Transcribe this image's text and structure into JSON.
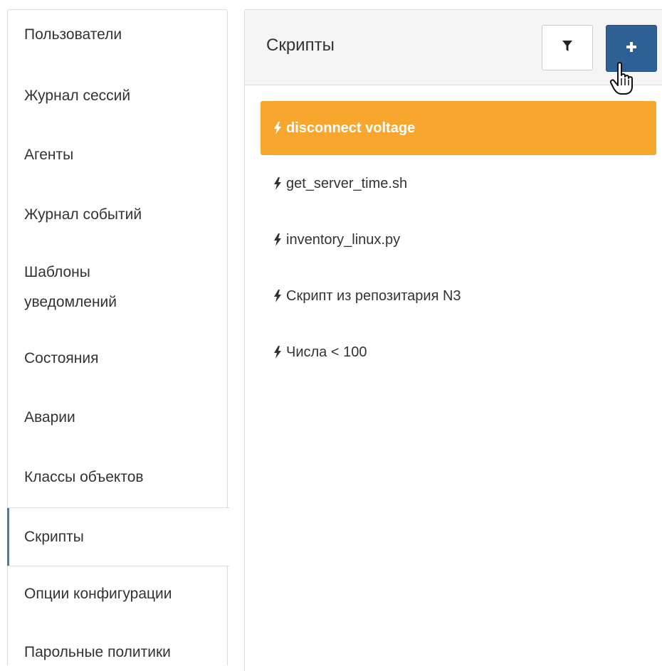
{
  "sidebar": {
    "items": [
      {
        "label": "Пользователи"
      },
      {
        "label": "Журнал сессий"
      },
      {
        "label": "Агенты"
      },
      {
        "label": "Журнал событий"
      },
      {
        "label": "Шаблоны уведомлений"
      },
      {
        "label": "Состояния"
      },
      {
        "label": "Аварии"
      },
      {
        "label": "Классы объектов"
      },
      {
        "label": "Скрипты",
        "active": true
      },
      {
        "label": "Опции конфигурации"
      },
      {
        "label": "Парольные политики"
      }
    ]
  },
  "panel": {
    "title": "Скрипты",
    "filter_icon": "filter-icon",
    "add_icon": "plus-icon"
  },
  "scripts": [
    {
      "name": "disconnect voltage",
      "active": true,
      "icon": "bolt-icon"
    },
    {
      "name": "get_server_time.sh",
      "icon": "bolt-icon"
    },
    {
      "name": "inventory_linux.py",
      "icon": "bolt-icon"
    },
    {
      "name": "Скрипт из репозитария N3",
      "icon": "bolt-icon"
    },
    {
      "name": "Числа < 100",
      "icon": "bolt-icon"
    }
  ],
  "colors": {
    "active_item": "#f8a72e",
    "add_button": "#2e6096",
    "active_nav_border": "#5a7a8c"
  }
}
